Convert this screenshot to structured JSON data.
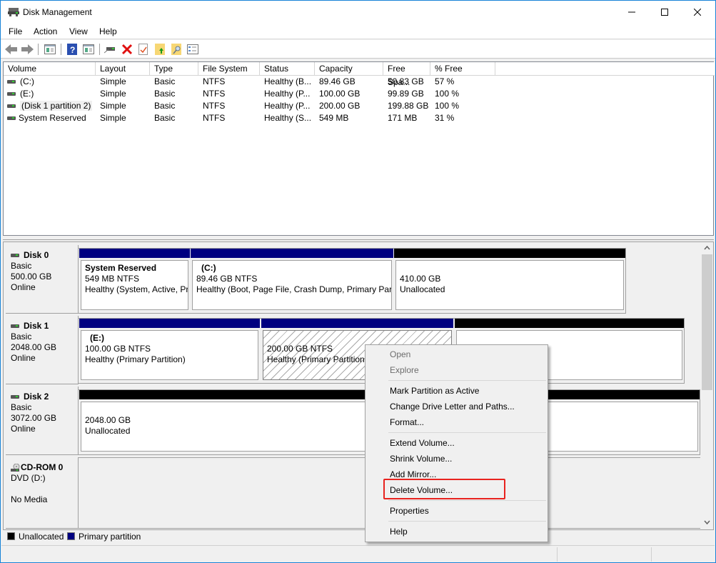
{
  "window": {
    "title": "Disk Management",
    "controls": {
      "minimize": "minimize-icon",
      "maximize": "maximize-icon",
      "close": "close-icon"
    }
  },
  "menubar": {
    "items": [
      "File",
      "Action",
      "View",
      "Help"
    ]
  },
  "toolbar": {
    "buttons": [
      "back-arrow-icon",
      "forward-arrow-icon",
      "show-hide-console-tree-icon",
      "help-icon",
      "show-hide-action-pane-icon",
      "connect-disk-icon",
      "delete-icon",
      "check-icon",
      "folder-up-icon",
      "folder-search-icon",
      "properties-list-icon"
    ]
  },
  "volume_list": {
    "columns": [
      "Volume",
      "Layout",
      "Type",
      "File System",
      "Status",
      "Capacity",
      "Free Spa...",
      "% Free"
    ],
    "rows": [
      {
        "volume": "(C:)",
        "layout": "Simple",
        "type": "Basic",
        "fs": "NTFS",
        "status": "Healthy (B...",
        "capacity": "89.46 GB",
        "free": "50.83 GB",
        "pct": "57 %"
      },
      {
        "volume": "(E:)",
        "layout": "Simple",
        "type": "Basic",
        "fs": "NTFS",
        "status": "Healthy (P...",
        "capacity": "100.00 GB",
        "free": "99.89 GB",
        "pct": "100 %"
      },
      {
        "volume": "(Disk 1 partition 2)",
        "layout": "Simple",
        "type": "Basic",
        "fs": "NTFS",
        "status": "Healthy (P...",
        "capacity": "200.00 GB",
        "free": "199.88 GB",
        "pct": "100 %"
      },
      {
        "volume": "System Reserved",
        "layout": "Simple",
        "type": "Basic",
        "fs": "NTFS",
        "status": "Healthy (S...",
        "capacity": "549 MB",
        "free": "171 MB",
        "pct": "31 %"
      }
    ]
  },
  "disks": [
    {
      "name": "Disk 0",
      "type": "Basic",
      "size": "500.00 GB",
      "state": "Online",
      "partitions": [
        {
          "title": "System Reserved",
          "size": "549 MB NTFS",
          "status": "Healthy (System, Active, Pr",
          "kind": "primary"
        },
        {
          "title": "(C:)",
          "size": "89.46 GB NTFS",
          "status": "Healthy (Boot, Page File, Crash Dump, Primary Part",
          "kind": "primary"
        },
        {
          "title": "",
          "size": "410.00 GB",
          "status": "Unallocated",
          "kind": "unallocated"
        }
      ]
    },
    {
      "name": "Disk 1",
      "type": "Basic",
      "size": "2048.00 GB",
      "state": "Online",
      "partitions": [
        {
          "title": "(E:)",
          "size": "100.00 GB NTFS",
          "status": "Healthy (Primary Partition)",
          "kind": "primary"
        },
        {
          "title": "",
          "size": "200.00 GB NTFS",
          "status": "Healthy (Primary Partition)",
          "kind": "primary",
          "selected": true
        },
        {
          "title": "",
          "size": "",
          "status": "",
          "kind": "unallocated"
        }
      ]
    },
    {
      "name": "Disk 2",
      "type": "Basic",
      "size": "3072.00 GB",
      "state": "Online",
      "partitions": [
        {
          "title": "",
          "size": "2048.00 GB",
          "status": "Unallocated",
          "kind": "unallocated"
        }
      ]
    },
    {
      "name": "CD-ROM 0",
      "type": "DVD (D:)",
      "size": "",
      "state": "No Media",
      "partitions": []
    }
  ],
  "legend": [
    {
      "label": "Unallocated",
      "color": "#000000"
    },
    {
      "label": "Primary partition",
      "color": "#000080"
    }
  ],
  "colors": {
    "primary": "#000080",
    "unallocated": "#000000",
    "highlight": "#e8231f"
  },
  "context_menu": {
    "items": [
      {
        "label": "Open",
        "disabled": true
      },
      {
        "label": "Explore",
        "disabled": true
      },
      {
        "separator": true
      },
      {
        "label": "Mark Partition as Active"
      },
      {
        "label": "Change Drive Letter and Paths..."
      },
      {
        "label": "Format..."
      },
      {
        "separator": true
      },
      {
        "label": "Extend Volume..."
      },
      {
        "label": "Shrink Volume..."
      },
      {
        "label": "Add Mirror..."
      },
      {
        "label": "Delete Volume...",
        "highlighted": true
      },
      {
        "separator": true
      },
      {
        "label": "Properties"
      },
      {
        "separator": true
      },
      {
        "label": "Help"
      }
    ]
  }
}
